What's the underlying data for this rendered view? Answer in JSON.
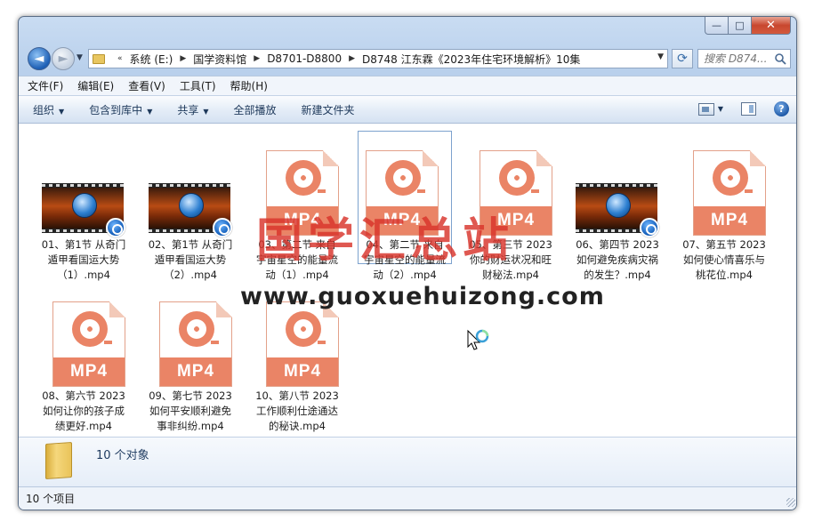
{
  "window": {
    "caption": {
      "minimize": "—",
      "maximize": "□",
      "close": "✕"
    }
  },
  "nav": {
    "back": "◄",
    "forward": "►",
    "breadcrumbs": [
      "系统 (E:)",
      "国学资料馆",
      "D8701-D8800",
      "D8748 江东霖《2023年住宅环境解析》10集"
    ],
    "search_placeholder": "搜索 D874..."
  },
  "menu": [
    "文件(F)",
    "编辑(E)",
    "查看(V)",
    "工具(T)",
    "帮助(H)"
  ],
  "commands": {
    "organize": "组织",
    "include_library": "包含到库中",
    "share": "共享",
    "play_all": "全部播放",
    "new_folder": "新建文件夹"
  },
  "files": [
    {
      "name": "01、第1节 从奇门遁甲看国运大势（1）.mp4",
      "thumb": "video"
    },
    {
      "name": "02、第1节 从奇门遁甲看国运大势（2）.mp4",
      "thumb": "video"
    },
    {
      "name": "03、第二节 来自宇宙星空的能量流动（1）.mp4",
      "thumb": "mp4"
    },
    {
      "name": "04、第二节 来自宇宙星空的能量流动（2）.mp4",
      "thumb": "mp4"
    },
    {
      "name": "05、第三节 2023你的财运状况和旺财秘法.mp4",
      "thumb": "mp4"
    },
    {
      "name": "06、第四节 2023如何避免疾病灾祸的发生？.mp4",
      "thumb": "video"
    },
    {
      "name": "07、第五节 2023如何使心情喜乐与桃花位.mp4",
      "thumb": "mp4"
    },
    {
      "name": "08、第六节 2023如何让你的孩子成绩更好.mp4",
      "thumb": "mp4"
    },
    {
      "name": "09、第七节 2023如何平安顺利避免事非纠纷.mp4",
      "thumb": "mp4"
    },
    {
      "name": "10、第八节 2023工作顺利仕途通达的秘诀.mp4",
      "thumb": "mp4"
    }
  ],
  "mp4_badge": "MP4",
  "watermark": {
    "title": "国学汇总站",
    "url": "www.guoxuehuizong.com"
  },
  "details": {
    "count": "10 个对象"
  },
  "status": {
    "count": "10 个项目"
  },
  "icons": {
    "help": "?",
    "refresh": "⟳"
  }
}
